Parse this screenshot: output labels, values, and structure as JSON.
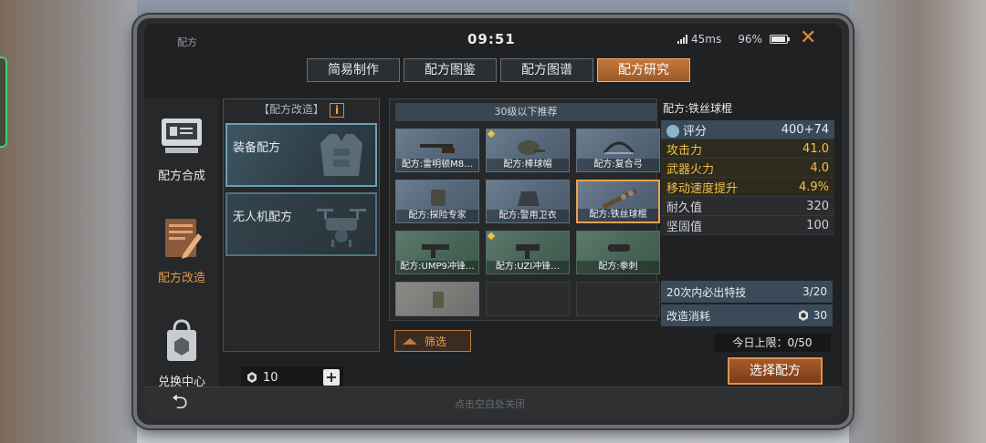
{
  "window": {
    "title": "配方",
    "time": "09:51",
    "ping": "45ms",
    "battery": "96%"
  },
  "tabs": [
    {
      "label": "简易制作",
      "active": false
    },
    {
      "label": "配方图鉴",
      "active": false
    },
    {
      "label": "配方图谱",
      "active": false
    },
    {
      "label": "配方研究",
      "active": true
    }
  ],
  "nav": [
    {
      "label": "配方合成",
      "icon": "crafting-terminal-icon",
      "active": false
    },
    {
      "label": "配方改造",
      "icon": "document-pencil-icon",
      "active": true
    },
    {
      "label": "兑换中心",
      "icon": "shopping-bag-icon",
      "active": false
    }
  ],
  "recipe_panel": {
    "header": "【配方改造】",
    "info_glyph": "i",
    "cards": [
      {
        "label": "装备配方",
        "icon": "armor-vest-icon"
      },
      {
        "label": "无人机配方",
        "icon": "drone-icon"
      }
    ]
  },
  "currency": {
    "amount": "10",
    "plus": "+"
  },
  "grid": {
    "heading": "30级以下推荐",
    "items": [
      {
        "label": "配方:雷明顿M8…",
        "tone": "blue",
        "badge": false
      },
      {
        "label": "配方:棒球帽",
        "tone": "blue",
        "badge": true
      },
      {
        "label": "配方:复合弓",
        "tone": "blue",
        "badge": false
      },
      {
        "label": "配方:探险专家",
        "tone": "blue",
        "badge": false
      },
      {
        "label": "配方:警用卫衣",
        "tone": "blue",
        "badge": false
      },
      {
        "label": "配方:铁丝球棍",
        "tone": "blue",
        "badge": false,
        "selected": true
      },
      {
        "label": "配方:UMP9冲锋…",
        "tone": "green",
        "badge": false
      },
      {
        "label": "配方:UZI冲锋…",
        "tone": "green",
        "badge": true
      },
      {
        "label": "配方:拳刺",
        "tone": "green",
        "badge": false
      }
    ]
  },
  "filter": {
    "label": "筛选"
  },
  "detail": {
    "title": "配方:铁丝球棍",
    "score": {
      "label": "评分",
      "value": "400+74"
    },
    "stats": [
      {
        "label": "攻击力",
        "value": "41.0",
        "highlight": true
      },
      {
        "label": "武器火力",
        "value": "4.0",
        "highlight": true
      },
      {
        "label": "移动速度提升",
        "value": "4.9%",
        "highlight": true
      },
      {
        "label": "耐久值",
        "value": "320",
        "highlight": false
      },
      {
        "label": "坚固值",
        "value": "100",
        "highlight": false
      }
    ],
    "guarantee": {
      "label": "20次内必出特技",
      "value": "3/20"
    },
    "cost": {
      "label": "改造消耗",
      "value": "30"
    }
  },
  "daily_limit": "今日上限：0/50",
  "select_button": "选择配方",
  "close_hint": "点击空白处关闭",
  "colors": {
    "accent": "#e08a3c",
    "highlight": "#f0c04a",
    "panel": "#262829"
  }
}
